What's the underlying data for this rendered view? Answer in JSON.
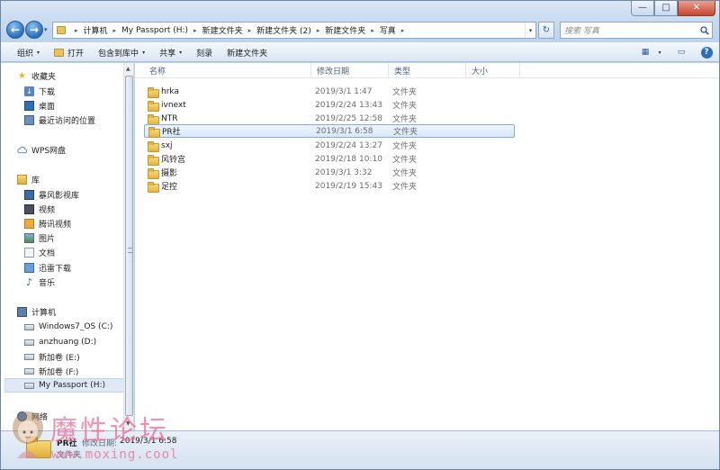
{
  "window": {
    "minimize_glyph": "—",
    "maximize_glyph": "□",
    "close_glyph": "✕"
  },
  "nav": {
    "back_glyph": "←",
    "forward_glyph": "→",
    "dropdown_glyph": "▾",
    "refresh_glyph": "↻",
    "breadcrumb": [
      "计算机",
      "My Passport (H:)",
      "新建文件夹",
      "新建文件夹 (2)",
      "新建文件夹",
      "写真"
    ],
    "breadcrumb_separator": "▸",
    "search_placeholder": "搜索 写真"
  },
  "toolbar": {
    "organize_label": "组织",
    "open_label": "打开",
    "include_label": "包含到库中",
    "share_label": "共享",
    "burn_label": "刻录",
    "new_folder_label": "新建文件夹",
    "caret": "▾",
    "view_glyph": "▦",
    "preview_glyph": "▭",
    "help_glyph": "?"
  },
  "sidebar": {
    "favorites_label": "收藏夹",
    "favorites": [
      {
        "label": "下载",
        "icon": "download-folder-icon"
      },
      {
        "label": "桌面",
        "icon": "desktop-icon"
      },
      {
        "label": "最近访问的位置",
        "icon": "recent-places-icon"
      }
    ],
    "wps_label": "WPS网盘",
    "libraries_label": "库",
    "libraries": [
      {
        "label": "暴风影视库",
        "icon": "video-library-icon"
      },
      {
        "label": "视频",
        "icon": "videos-icon"
      },
      {
        "label": "腾讯视频",
        "icon": "tencent-video-icon"
      },
      {
        "label": "图片",
        "icon": "pictures-icon"
      },
      {
        "label": "文档",
        "icon": "documents-icon"
      },
      {
        "label": "迅雷下载",
        "icon": "thunder-download-icon"
      },
      {
        "label": "音乐",
        "icon": "music-icon"
      }
    ],
    "computer_label": "计算机",
    "drives": [
      {
        "label": "Windows7_OS (C:)",
        "icon": "drive-icon"
      },
      {
        "label": "anzhuang (D:)",
        "icon": "drive-icon"
      },
      {
        "label": "新加卷 (E:)",
        "icon": "drive-icon"
      },
      {
        "label": "新加卷 (F:)",
        "icon": "drive-icon"
      },
      {
        "label": "My Passport (H:)",
        "icon": "drive-icon",
        "selected": true
      }
    ],
    "network_label": "网络"
  },
  "file_list": {
    "columns": [
      "名称",
      "修改日期",
      "类型",
      "大小"
    ],
    "sort_indicator": "^",
    "rows": [
      {
        "name": "hrka",
        "modified": "2019/3/1 1:47",
        "type": "文件夹"
      },
      {
        "name": "ivnext",
        "modified": "2019/2/24 13:43",
        "type": "文件夹"
      },
      {
        "name": "NTR",
        "modified": "2019/2/25 12:58",
        "type": "文件夹"
      },
      {
        "name": "PR社",
        "modified": "2019/3/1 6:58",
        "type": "文件夹",
        "selected": true
      },
      {
        "name": "sxj",
        "modified": "2019/2/24 13:27",
        "type": "文件夹"
      },
      {
        "name": "风铃宫",
        "modified": "2019/2/18 10:10",
        "type": "文件夹"
      },
      {
        "name": "摄影",
        "modified": "2019/3/1 3:32",
        "type": "文件夹"
      },
      {
        "name": "足控",
        "modified": "2019/2/19 15:43",
        "type": "文件夹"
      }
    ]
  },
  "details": {
    "name": "PR社",
    "date_label": "修改日期:",
    "date_value": "2019/3/1 6:58",
    "type": "文件夹"
  },
  "watermark": {
    "title": "魔性论坛",
    "url": "www.moxing.cool"
  },
  "colors": {
    "accent": "#2a6fbd",
    "selection_border": "#84acdd",
    "folder": "#e3b43f",
    "watermark": "#ec6e96"
  }
}
